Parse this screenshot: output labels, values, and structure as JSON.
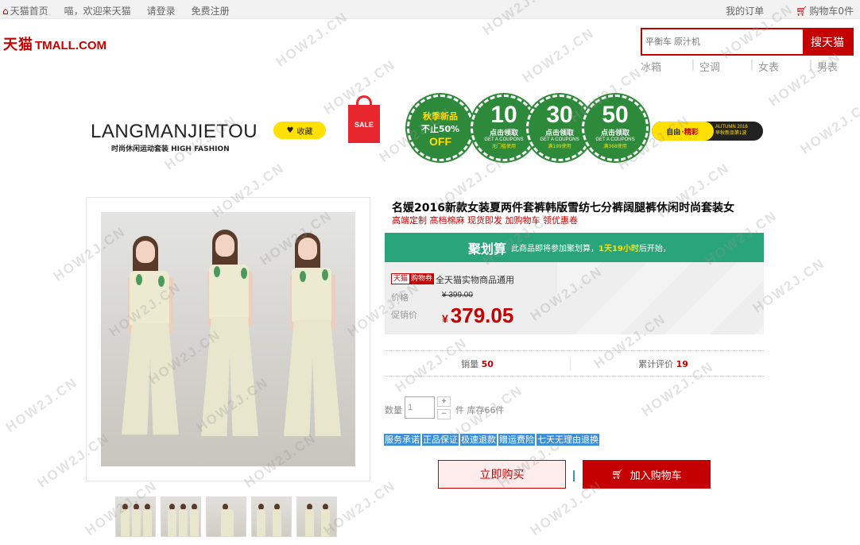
{
  "topbar": {
    "home": "天猫首页",
    "welcome": "喵，欢迎来天猫",
    "login": "请登录",
    "register": "免费注册",
    "my_orders": "我的订单",
    "cart": "购物车0件"
  },
  "logo": {
    "cn": "天猫",
    "en": "TMALL.COM"
  },
  "search": {
    "placeholder": "平衡车 原汁机",
    "button": "搜天猫"
  },
  "hotwords": [
    "冰箱",
    "空调",
    "女表",
    "男表"
  ],
  "banner": {
    "brand": "LANGMANJIETOU",
    "brand_sub": "时尚休闲运动套装 HIGH FASHION",
    "favorite": "收藏",
    "sale": "SALE",
    "first_coupon": {
      "line1": "秋季新品",
      "line2": "不止50%",
      "line3": "OFF"
    },
    "coupons": [
      {
        "amount": "10",
        "action": "点击领取",
        "en": "GET A COUPONS",
        "cond": "无门槛使用"
      },
      {
        "amount": "30",
        "action": "点击领取",
        "en": "GET A COUPONS",
        "cond": "满199使用"
      },
      {
        "amount": "50",
        "action": "点击领取",
        "en": "GET A COUPONS",
        "cond": "满368使用"
      }
    ],
    "pill": {
      "a": "自由",
      "b": "·精彩",
      "c": "AUTUMN 2016",
      "d": "早秋新品第1波"
    }
  },
  "product": {
    "title": "名媛2016新款女装夏两件套裤韩版雪纺七分裤阔腿裤休闲时尚套装女",
    "subtitle": "高端定制 高档棉麻 现货即发 加购物车 领优惠卷",
    "juhuasuan": {
      "name": "聚划算",
      "text_before": "此商品即将参加聚划算，",
      "highlight": "1天19小时",
      "text_after": "后开始，"
    },
    "tag_tmall": "天猫",
    "tag_coupon": "购物券",
    "coupon_text": "全天猫实物商品通用",
    "price_label": "价格",
    "original_price": "¥ 399.00",
    "promo_label": "促销价",
    "currency": "¥",
    "promo_price": "379.05",
    "sales_label": "销量",
    "sales": "50",
    "reviews_label": "累计评价",
    "reviews": "19",
    "qty_label": "数量",
    "qty_value": "1",
    "stock": "件 库存66件",
    "promises": [
      "服务承诺",
      "正品保证",
      "极速退款",
      "赠运费险",
      "七天无理由退换"
    ],
    "buy_now": "立即购买",
    "add_cart": "加入购物车"
  },
  "watermark": "HOW2J.CN",
  "colors": {
    "brand": "#c40000",
    "juhuasuan": "#2aa47a",
    "promise": "#3b8fd8"
  }
}
